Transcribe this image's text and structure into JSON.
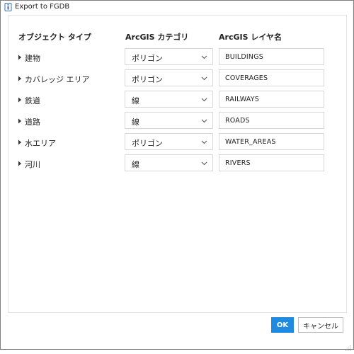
{
  "window": {
    "title": "Export to FGDB"
  },
  "columns": {
    "object_type": "オブジェクト タイプ",
    "arcgis_category": "ArcGIS カテゴリ",
    "arcgis_layer_name": "ArcGIS レイヤ名"
  },
  "rows": [
    {
      "type": "建物",
      "category": "ポリゴン",
      "layer": "BUILDINGS"
    },
    {
      "type": "カバレッジ エリア",
      "category": "ポリゴン",
      "layer": "COVERAGES"
    },
    {
      "type": "鉄道",
      "category": "線",
      "layer": "RAILWAYS"
    },
    {
      "type": "道路",
      "category": "線",
      "layer": "ROADS"
    },
    {
      "type": "水エリア",
      "category": "ポリゴン",
      "layer": "WATER_AREAS"
    },
    {
      "type": "河川",
      "category": "線",
      "layer": "RIVERS"
    }
  ],
  "buttons": {
    "ok": "OK",
    "cancel": "キャンセル"
  },
  "colors": {
    "accent": "#1f8be0",
    "border": "#d8d8d8"
  }
}
